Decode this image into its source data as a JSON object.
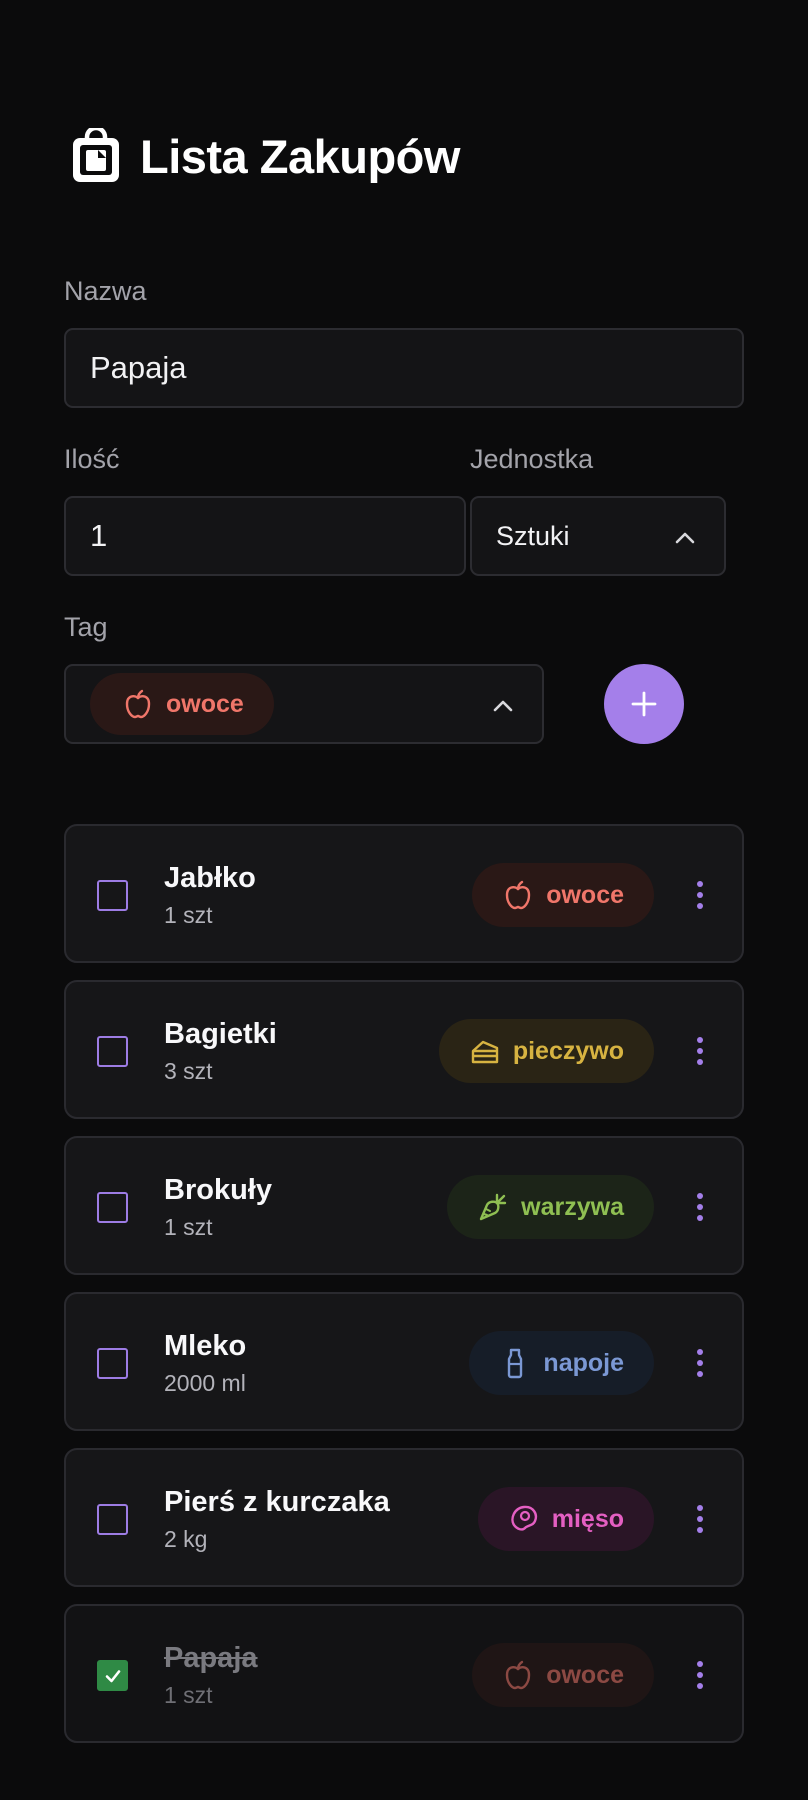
{
  "header": {
    "title": "Lista Zakupów",
    "icon": "shopping-bag-icon"
  },
  "form": {
    "name_label": "Nazwa",
    "name_value": "Papaja",
    "qty_label": "Ilość",
    "qty_value": "1",
    "unit_label": "Jednostka",
    "unit_value": "Sztuki",
    "tag_label": "Tag",
    "tag_value": "owoce",
    "add_icon": "plus-icon"
  },
  "colors": {
    "accent": "#a47fea",
    "fruit": "#f0766a",
    "bread": "#d7b341",
    "veg": "#8fbf52",
    "drink": "#7b98d4",
    "meat": "#e45fc2",
    "checked": "#2f8a45"
  },
  "items": [
    {
      "name": "Jabłko",
      "qty": "1 szt",
      "tag": "owoce",
      "icon": "apple-icon",
      "checked": false
    },
    {
      "name": "Bagietki",
      "qty": "3 szt",
      "tag": "pieczywo",
      "icon": "bread-icon",
      "checked": false
    },
    {
      "name": "Brokuły",
      "qty": "1 szt",
      "tag": "warzywa",
      "icon": "carrot-icon",
      "checked": false
    },
    {
      "name": "Mleko",
      "qty": "2000 ml",
      "tag": "napoje",
      "icon": "bottle-icon",
      "checked": false
    },
    {
      "name": "Pierś z kurczaka",
      "qty": "2 kg",
      "tag": "mięso",
      "icon": "steak-icon",
      "checked": false
    },
    {
      "name": "Papaja",
      "qty": "1 szt",
      "tag": "owoce",
      "icon": "apple-icon",
      "checked": true
    }
  ]
}
